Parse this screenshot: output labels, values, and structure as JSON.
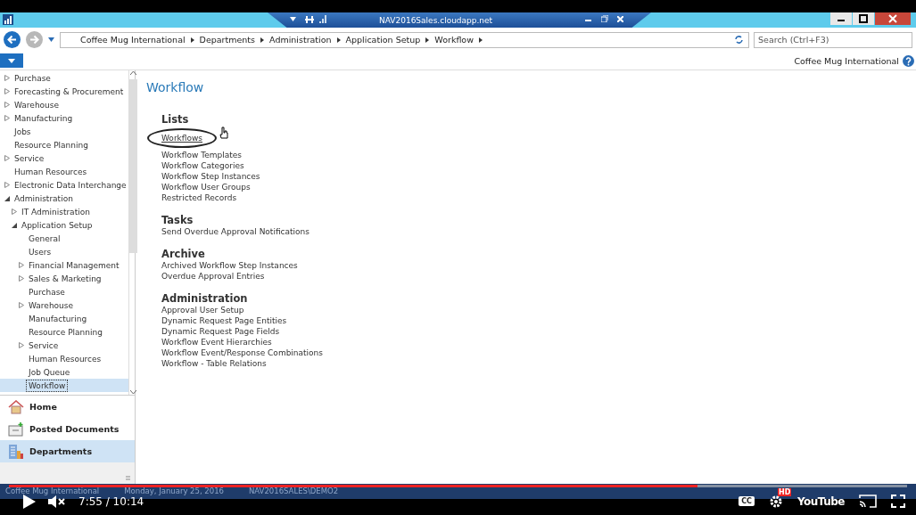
{
  "window": {
    "title": "NAV2016Sales.cloudapp.net"
  },
  "navigation": {
    "breadcrumbs": [
      "Coffee Mug International",
      "Departments",
      "Administration",
      "Application Setup",
      "Workflow"
    ],
    "search": {
      "placeholder": "Search (Ctrl+F3)"
    }
  },
  "company": "Coffee Mug International",
  "sidebar": {
    "tree": [
      {
        "label": "Purchase",
        "kind": "group",
        "expanded": false,
        "selected": false
      },
      {
        "label": "Forecasting & Procurement",
        "kind": "group",
        "expanded": false,
        "selected": false
      },
      {
        "label": "Warehouse",
        "kind": "group",
        "expanded": false,
        "selected": false
      },
      {
        "label": "Manufacturing",
        "kind": "group",
        "expanded": false,
        "selected": false
      },
      {
        "label": "Jobs",
        "kind": "leaf",
        "selected": false
      },
      {
        "label": "Resource Planning",
        "kind": "leaf",
        "selected": false
      },
      {
        "label": "Service",
        "kind": "group",
        "expanded": false,
        "selected": false
      },
      {
        "label": "Human Resources",
        "kind": "leaf",
        "selected": false
      },
      {
        "label": "Electronic Data Interchange",
        "kind": "group",
        "expanded": false,
        "selected": false
      },
      {
        "label": "Administration",
        "kind": "group",
        "expanded": true,
        "selected": false,
        "children": [
          {
            "label": "IT Administration",
            "kind": "group",
            "expanded": false,
            "selected": false
          },
          {
            "label": "Application Setup",
            "kind": "group",
            "expanded": true,
            "selected": false,
            "children": [
              {
                "label": "General",
                "kind": "leaf",
                "selected": false
              },
              {
                "label": "Users",
                "kind": "leaf",
                "selected": false
              },
              {
                "label": "Financial Management",
                "kind": "group",
                "expanded": false,
                "selected": false
              },
              {
                "label": "Sales & Marketing",
                "kind": "group",
                "expanded": false,
                "selected": false
              },
              {
                "label": "Purchase",
                "kind": "leaf",
                "selected": false
              },
              {
                "label": "Warehouse",
                "kind": "group",
                "expanded": false,
                "selected": false
              },
              {
                "label": "Manufacturing",
                "kind": "leaf",
                "selected": false
              },
              {
                "label": "Resource Planning",
                "kind": "leaf",
                "selected": false
              },
              {
                "label": "Service",
                "kind": "group",
                "expanded": false,
                "selected": false
              },
              {
                "label": "Human Resources",
                "kind": "leaf",
                "selected": false
              },
              {
                "label": "Job Queue",
                "kind": "leaf",
                "selected": false
              },
              {
                "label": "Workflow",
                "kind": "leaf",
                "selected": true
              }
            ]
          }
        ]
      }
    ],
    "buttons": [
      {
        "label": "Home",
        "kind": "home",
        "selected": false
      },
      {
        "label": "Posted Documents",
        "kind": "posted",
        "selected": false
      },
      {
        "label": "Departments",
        "kind": "departments",
        "selected": true
      }
    ]
  },
  "page": {
    "title": "Workflow",
    "groups": [
      {
        "heading": "Lists",
        "links": [
          {
            "label": "Workflows",
            "highlighted": true
          },
          {
            "label": "Workflow Templates",
            "highlighted": false
          },
          {
            "label": "Workflow Categories",
            "highlighted": false
          },
          {
            "label": "Workflow Step Instances",
            "highlighted": false
          },
          {
            "label": "Workflow User Groups",
            "highlighted": false
          },
          {
            "label": "Restricted Records",
            "highlighted": false
          }
        ]
      },
      {
        "heading": "Tasks",
        "links": [
          {
            "label": "Send Overdue Approval Notifications",
            "highlighted": false
          }
        ]
      },
      {
        "heading": "Archive",
        "links": [
          {
            "label": "Archived Workflow Step Instances",
            "highlighted": false
          },
          {
            "label": "Overdue Approval Entries",
            "highlighted": false
          }
        ]
      },
      {
        "heading": "Administration",
        "links": [
          {
            "label": "Approval User Setup",
            "highlighted": false
          },
          {
            "label": "Dynamic Request Page Entities",
            "highlighted": false
          },
          {
            "label": "Dynamic Request Page Fields",
            "highlighted": false
          },
          {
            "label": "Workflow Event Hierarchies",
            "highlighted": false
          },
          {
            "label": "Workflow Event/Response Combinations",
            "highlighted": false
          },
          {
            "label": "Workflow - Table Relations",
            "highlighted": false
          }
        ]
      }
    ]
  },
  "status_bar": [
    "Coffee Mug International",
    "Monday, January 25, 2016",
    "NAV2016SALES\\DEMO2"
  ],
  "player": {
    "level": 0.767,
    "time": "7:55 / 10:14",
    "muted": true,
    "captions": "CC",
    "quality": "HD",
    "logo": "YouTube"
  }
}
